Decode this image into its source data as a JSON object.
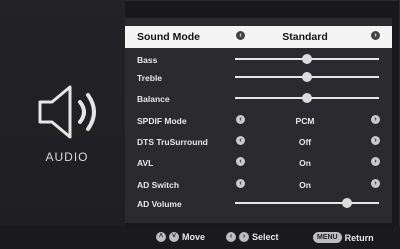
{
  "side": {
    "label": "AUDIO",
    "icon": "speaker-icon"
  },
  "menu": {
    "items": [
      {
        "label": "Sound Mode",
        "value": "Standard",
        "type": "select",
        "selected": true
      },
      {
        "label": "Bass",
        "type": "slider",
        "level": 0.5
      },
      {
        "label": "Treble",
        "type": "slider",
        "level": 0.5
      },
      {
        "label": "Balance",
        "type": "slider",
        "level": 0.5
      },
      {
        "label": "SPDIF Mode",
        "value": "PCM",
        "type": "select"
      },
      {
        "label": "DTS TruSurround",
        "value": "Off",
        "type": "select"
      },
      {
        "label": "AVL",
        "value": "On",
        "type": "select"
      },
      {
        "label": "AD Switch",
        "value": "On",
        "type": "select"
      },
      {
        "label": "AD Volume",
        "type": "slider",
        "level": 0.78
      }
    ]
  },
  "footer": {
    "move": "Move",
    "select": "Select",
    "menu_key": "MENU",
    "return": "Return"
  }
}
